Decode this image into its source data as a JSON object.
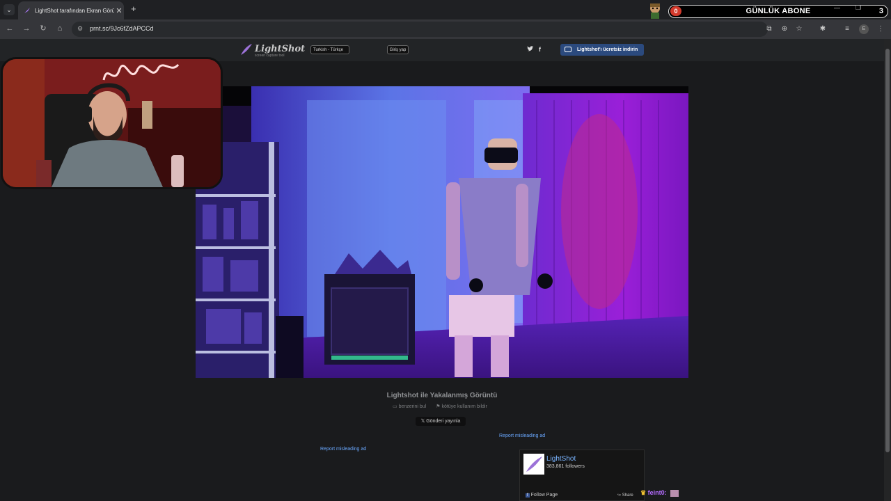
{
  "browser": {
    "tab_title": "LightShot tarafından Ekran Görüntüsü",
    "tab_close": "✕",
    "new_tab": "+",
    "url": "prnt.sc/9Jc6fZdAPCCd",
    "window_controls": {
      "minimize": "—",
      "restore": "❐"
    }
  },
  "stream_overlay": {
    "label": "GÜNLÜK ABONE",
    "count_left": "0",
    "count_right": "3"
  },
  "lightshot": {
    "logo": "LightShot",
    "tagline": "screen capture tool",
    "language": "Turkish - Türkçe",
    "login": "Giriş yap",
    "social": {
      "twitter": "🐦",
      "facebook": "f"
    },
    "download_button": "Lightshot'ı ücretsiz indirin",
    "caption_title": "Lightshot ile Yakalanmış Görüntü",
    "find_similar": "benzerini bul",
    "report_abuse": "kötüye kullanım bildir",
    "tweet_button": "Gönderi yayınla",
    "report_ad_1": "Report misleading ad",
    "report_ad_2": "Report misleading ad",
    "fb_widget": {
      "name": "LightShot",
      "followers": "383,861 followers",
      "follow": "Follow Page",
      "share": "Share"
    }
  },
  "chat": {
    "user": "feint0:"
  },
  "icons": {
    "back": "back-arrow-icon",
    "forward": "forward-arrow-icon",
    "reload": "reload-icon",
    "home": "home-icon",
    "zoom": "zoom-icon",
    "bookmark": "star-icon",
    "extensions": "puzzle-icon",
    "menu": "kebab-menu-icon"
  },
  "colors": {
    "accent_blue": "#2b4a7e",
    "link": "#6aa8ff",
    "overlay_badge": "#d43a2c"
  }
}
